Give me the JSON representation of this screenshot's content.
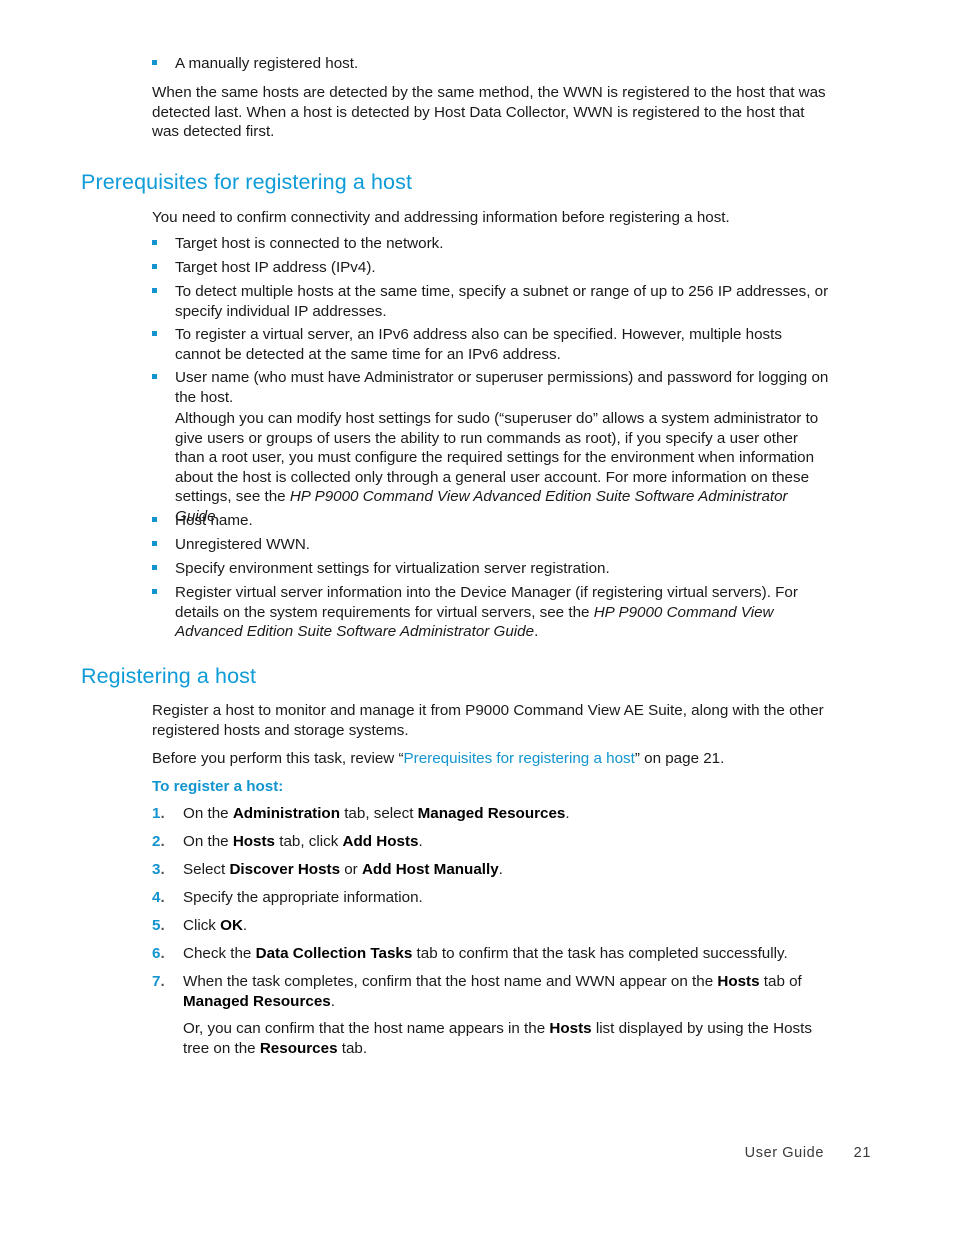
{
  "page": {
    "footer_label": "User Guide",
    "footer_page_number": "21",
    "accent_color": "#1295cf",
    "heading_color": "#0e9bd8",
    "body_color": "#1a1a1a"
  },
  "intro": {
    "bullet": "A manually registered host.",
    "paragraph": "When the same hosts are detected by the same method, the WWN is registered to the host that was detected last. When a host is detected by Host Data Collector, WWN is registered to the host that was detected first."
  },
  "section_prerequisites": {
    "heading": "Prerequisites for registering a host",
    "intro_paragraph": "You need to confirm connectivity and addressing information before registering a host.",
    "bullets": [
      "Target host is connected to the network.",
      "Target host IP address (IPv4).",
      "To detect multiple hosts at the same time, specify a subnet or range of up to 256 IP addresses, or specify individual IP addresses.",
      "To register a virtual server, an IPv6 address also can be specified. However, multiple hosts cannot be detected at the same time for an IPv6 address.",
      "User name (who must have Administrator or superuser permissions) and password for logging on the host.",
      "Host name.",
      "Unregistered WWN.",
      "Specify environment settings for virtualization server registration."
    ],
    "sudo_note": {
      "text_before_italic": "Although you can modify host settings for sudo (“superuser do” allows a system administrator to give users or groups of users the ability to run commands as root), if you specify a user other than a root user, you must configure the required settings for the environment when information about the host is collected only through a general user account. For more information on these settings, see the ",
      "italic_title": "HP P9000 Command View Advanced Edition Suite Software Administrator Guide",
      "text_after_italic": "."
    },
    "last_bullet": {
      "text_before_italic": "Register virtual server information into the Device Manager (if registering virtual servers). For details on the system requirements for virtual servers, see the ",
      "italic_title": "HP P9000 Command View Advanced Edition Suite Software Administrator Guide",
      "text_after_italic": "."
    }
  },
  "section_registering": {
    "heading": "Registering a host",
    "intro_paragraph": "Register a host to monitor and manage it from P9000 Command View AE Suite, along with the other registered hosts and storage systems.",
    "cross_reference": {
      "prefix": "Before you perform this task, review “",
      "link_text": "Prerequisites for registering a host",
      "suffix": "” on page 21."
    },
    "procedure_title": "To register a host:",
    "steps": [
      {
        "number": "1",
        "parts": [
          {
            "t": "On the ",
            "style": "normal"
          },
          {
            "t": "Administration",
            "style": "bold"
          },
          {
            "t": " tab, select ",
            "style": "normal"
          },
          {
            "t": "Managed Resources",
            "style": "bold"
          },
          {
            "t": ".",
            "style": "normal"
          }
        ]
      },
      {
        "number": "2",
        "parts": [
          {
            "t": "On the ",
            "style": "normal"
          },
          {
            "t": "Hosts",
            "style": "bold"
          },
          {
            "t": " tab, click ",
            "style": "normal"
          },
          {
            "t": "Add Hosts",
            "style": "bold"
          },
          {
            "t": ".",
            "style": "normal"
          }
        ]
      },
      {
        "number": "3",
        "parts": [
          {
            "t": "Select ",
            "style": "normal"
          },
          {
            "t": "Discover Hosts",
            "style": "bold"
          },
          {
            "t": " or ",
            "style": "normal"
          },
          {
            "t": "Add Host Manually",
            "style": "bold"
          },
          {
            "t": ".",
            "style": "normal"
          }
        ]
      },
      {
        "number": "4",
        "parts": [
          {
            "t": "Specify the appropriate information.",
            "style": "normal"
          }
        ]
      },
      {
        "number": "5",
        "parts": [
          {
            "t": "Click ",
            "style": "normal"
          },
          {
            "t": "OK",
            "style": "bold"
          },
          {
            "t": ".",
            "style": "normal"
          }
        ]
      },
      {
        "number": "6",
        "parts": [
          {
            "t": "Check the ",
            "style": "normal"
          },
          {
            "t": "Data Collection Tasks",
            "style": "bold"
          },
          {
            "t": " tab to confirm that the task has completed successfully.",
            "style": "normal"
          }
        ]
      },
      {
        "number": "7",
        "parts": [
          {
            "t": "When the task completes, confirm that the host name and WWN appear on the ",
            "style": "normal"
          },
          {
            "t": "Hosts",
            "style": "bold"
          },
          {
            "t": " tab of ",
            "style": "normal"
          },
          {
            "t": "Managed Resources",
            "style": "bold"
          },
          {
            "t": ".",
            "style": "normal"
          }
        ]
      }
    ],
    "step7_followup": [
      {
        "t": "Or, you can confirm that the host name appears in the ",
        "style": "normal"
      },
      {
        "t": "Hosts",
        "style": "bold"
      },
      {
        "t": " list displayed by using the Hosts tree on the ",
        "style": "normal"
      },
      {
        "t": "Resources",
        "style": "bold"
      },
      {
        "t": " tab.",
        "style": "normal"
      }
    ]
  }
}
